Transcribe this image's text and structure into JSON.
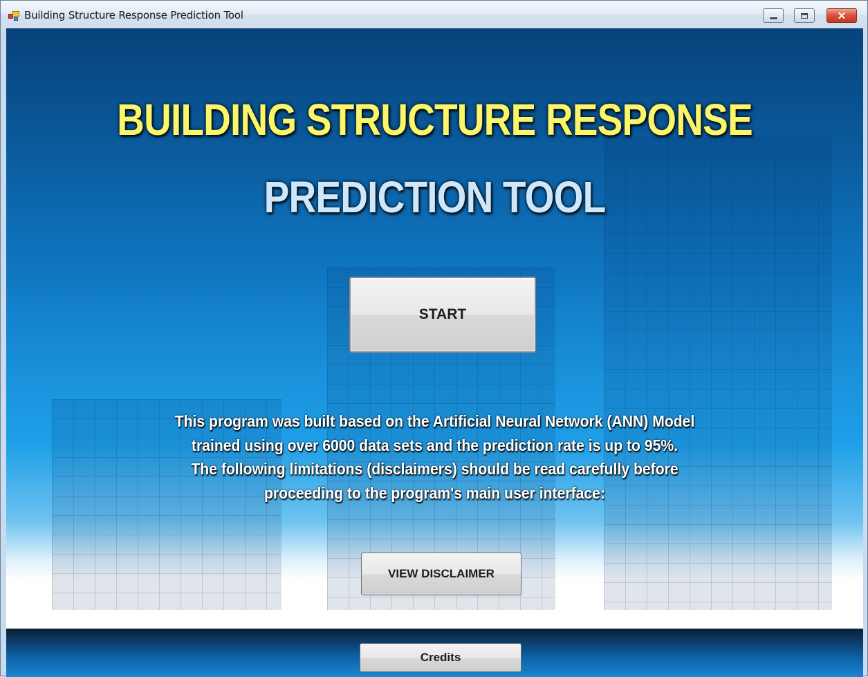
{
  "window": {
    "title": "Building Structure Response Prediction Tool",
    "controls": {
      "minimize": "–",
      "maximize": "□",
      "close": "✕"
    }
  },
  "header": {
    "title_line1": "BUILDING STRUCTURE RESPONSE",
    "title_line2": "PREDICTION TOOL"
  },
  "buttons": {
    "start": "START",
    "view_disclaimer": "VIEW DISCLAIMER",
    "credits": "Credits"
  },
  "description": {
    "lines": [
      "This program was built based on the Artificial Neural Network (ANN) Model",
      "trained using over 6000 data sets and the prediction rate is up to 95%.",
      "The following limitations (disclaimers) should be read carefully before",
      "proceeding to the program's main user interface:"
    ]
  },
  "colors": {
    "title_line1": "#fbf56a",
    "title_line2": "#cfe7fb",
    "background_top": "#08427a",
    "background_mid": "#1e9fe8",
    "footer": "#0d63a8"
  }
}
